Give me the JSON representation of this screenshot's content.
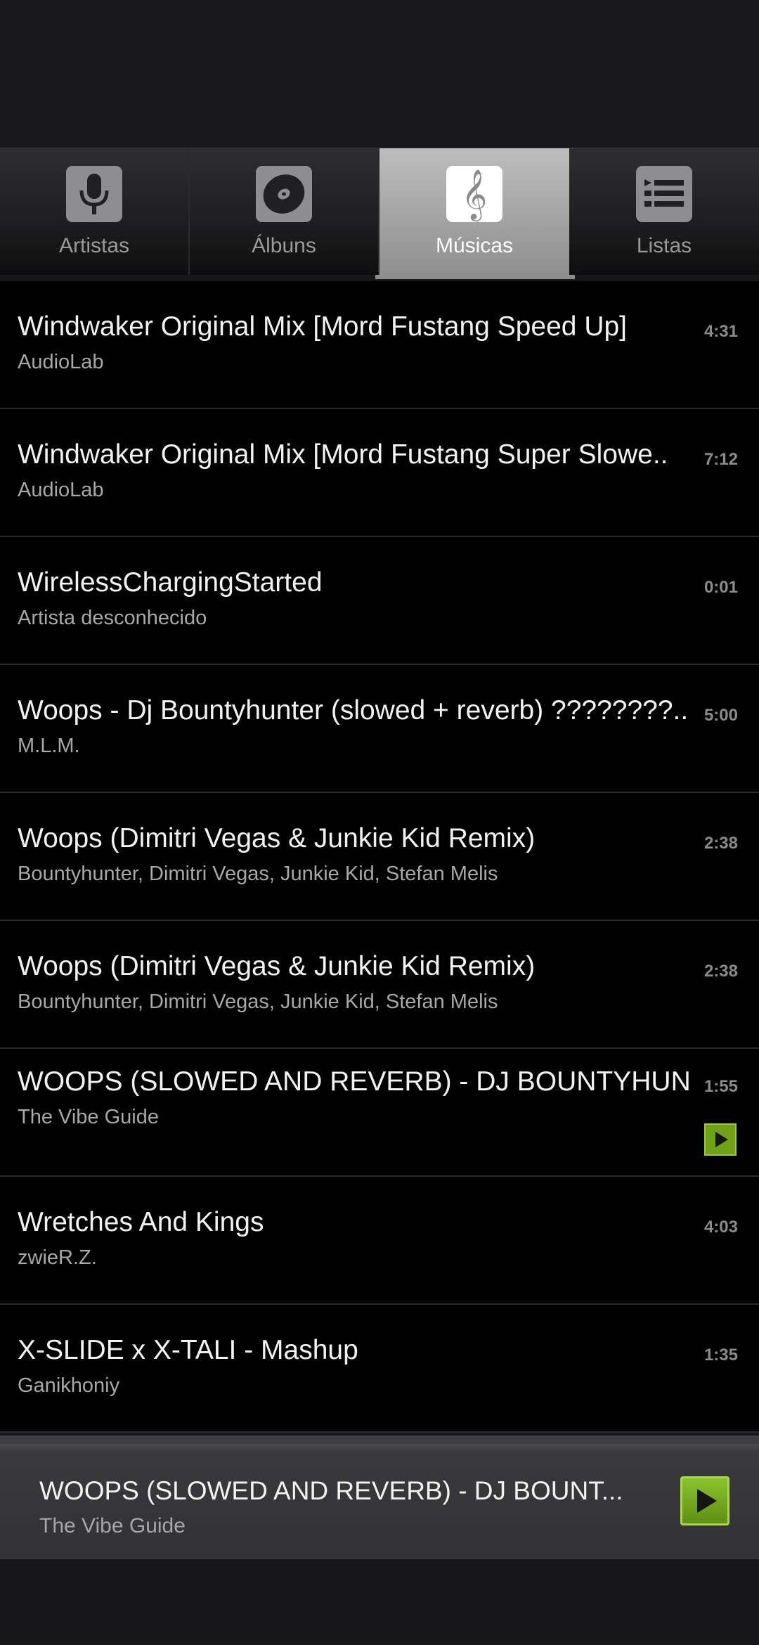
{
  "tabs": [
    {
      "label": "Artistas",
      "icon": "microphone-icon",
      "active": false
    },
    {
      "label": "Álbuns",
      "icon": "disc-icon",
      "active": false
    },
    {
      "label": "Músicas",
      "icon": "treble-clef-icon",
      "active": true
    },
    {
      "label": "Listas",
      "icon": "list-icon",
      "active": false
    }
  ],
  "songs": [
    {
      "title": "Windwaker Original Mix [Mord Fustang Speed Up]",
      "artist": "AudioLab",
      "duration": "4:31"
    },
    {
      "title": "Windwaker Original Mix [Mord Fustang Super Slowe..",
      "artist": "AudioLab",
      "duration": "7:12"
    },
    {
      "title": "WirelessChargingStarted",
      "artist": "Artista desconhecido",
      "duration": "0:01"
    },
    {
      "title": "Woops - Dj Bountyhunter (slowed + reverb) ????????..",
      "artist": "M.L.M.",
      "duration": "5:00"
    },
    {
      "title": "Woops (Dimitri Vegas & Junkie Kid Remix)",
      "artist": "Bountyhunter, Dimitri Vegas, Junkie Kid, Stefan Melis",
      "duration": "2:38"
    },
    {
      "title": "Woops (Dimitri Vegas & Junkie Kid Remix)",
      "artist": "Bountyhunter, Dimitri Vegas, Junkie Kid, Stefan Melis",
      "duration": "2:38"
    },
    {
      "title": "WOOPS (SLOWED AND REVERB) - DJ BOUNTYHUN..",
      "artist": "The Vibe Guide",
      "duration": "1:55",
      "playing": true
    },
    {
      "title": "Wretches And Kings",
      "artist": "zwieR.Z.",
      "duration": "4:03"
    },
    {
      "title": "X-SLIDE x X-TALI - Mashup",
      "artist": "Ganikhoniy",
      "duration": "1:35"
    }
  ],
  "now_playing": {
    "title": "WOOPS (SLOWED AND REVERB) - DJ BOUNT...",
    "artist": "The Vibe Guide",
    "play_icon": "play-icon"
  },
  "colors": {
    "accent_green": "#6fa216",
    "active_tab": "#a6a6a6"
  }
}
